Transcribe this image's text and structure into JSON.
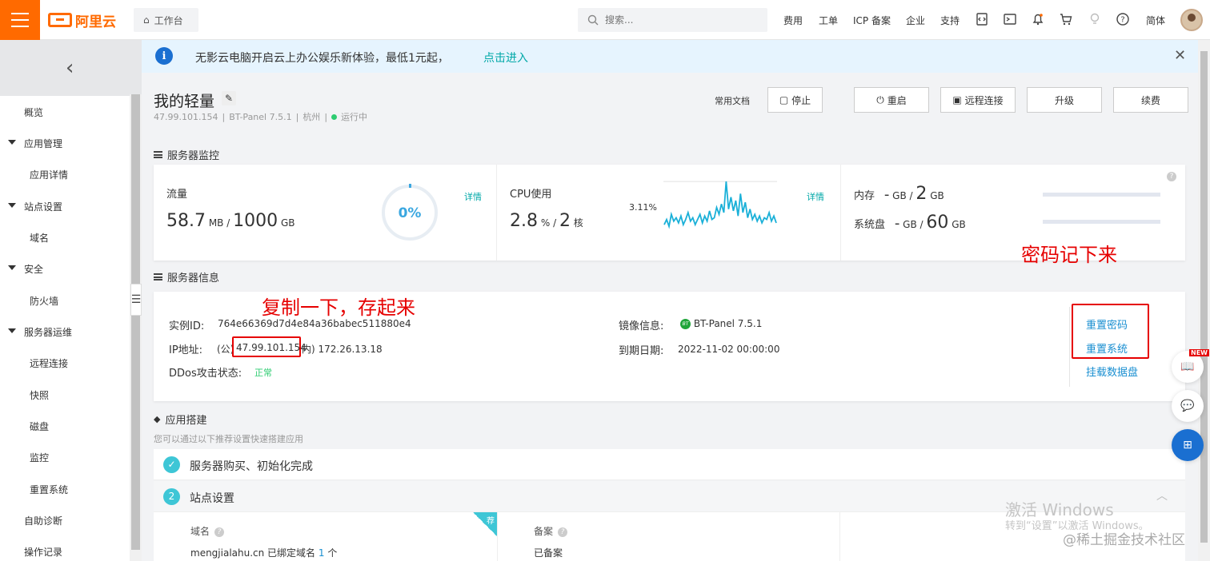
{
  "topbar": {
    "logo_text": "阿里云",
    "workbench": "工作台",
    "search_placeholder": "搜索...",
    "nav": [
      "费用",
      "工单",
      "ICP 备案",
      "企业",
      "支持"
    ],
    "lang": "简体"
  },
  "sidebar": {
    "items": [
      {
        "label": "概览"
      },
      {
        "label": "应用管理"
      },
      {
        "label": "应用详情"
      },
      {
        "label": "站点设置"
      },
      {
        "label": "域名"
      },
      {
        "label": "安全"
      },
      {
        "label": "防火墙"
      },
      {
        "label": "服务器运维"
      },
      {
        "label": "远程连接"
      },
      {
        "label": "快照"
      },
      {
        "label": "磁盘"
      },
      {
        "label": "监控"
      },
      {
        "label": "重置系统"
      },
      {
        "label": "自助诊断"
      },
      {
        "label": "操作记录"
      }
    ]
  },
  "notice": {
    "message": "无影云电脑开启云上办公娱乐新体验，最低1元起，",
    "link": "点击进入"
  },
  "header": {
    "title": "我的轻量",
    "ip": "47.99.101.154",
    "image": "BT-Panel 7.5.1",
    "region": "杭州",
    "status": "运行中",
    "docs": "常用文档",
    "buttons": {
      "stop": "停止",
      "restart": "重启",
      "remote": "远程连接",
      "upgrade": "升级",
      "renew": "续费"
    }
  },
  "monitor": {
    "section": "服务器监控",
    "traffic": {
      "label": "流量",
      "used": "58.7",
      "used_unit": "MB",
      "total": "1000",
      "total_unit": "GB",
      "percent": "0%",
      "detail": "详情"
    },
    "cpu": {
      "label": "CPU使用",
      "value": "2.8",
      "unit": "%",
      "cores": "2",
      "cores_unit": "核",
      "peak": "3.11%",
      "detail": "详情"
    },
    "memory": {
      "label": "内存",
      "used": "-",
      "used_unit": "GB",
      "total": "2",
      "total_unit": "GB"
    },
    "disk": {
      "label": "系统盘",
      "used": "-",
      "used_unit": "GB",
      "total": "60",
      "total_unit": "GB"
    }
  },
  "info": {
    "section": "服务器信息",
    "instance_label": "实例ID:",
    "instance_id": "764e66369d7d4e84a36babec511880e4",
    "ip_label": "IP地址:",
    "ip_prefix": "(公)",
    "public_ip": "47.99.101.154",
    "private_ip": "内) 172.26.13.18",
    "ddos_label": "DDos攻击状态:",
    "ddos_status": "正常",
    "image_label": "镜像信息:",
    "image_icon": "BT",
    "image_value": "BT-Panel 7.5.1",
    "expire_label": "到期日期:",
    "expire_value": "2022-11-02 00:00:00",
    "actions": [
      "重置密码",
      "重置系统",
      "挂载数据盘"
    ]
  },
  "annotations": {
    "copy_note": "复制一下，存起来",
    "password_note": "密码记下来"
  },
  "apps": {
    "section": "应用搭建",
    "hint": "您可以通过以下推荐设置快速搭建应用",
    "steps": [
      {
        "num": "✓",
        "label": "服务器购买、初始化完成"
      },
      {
        "num": "2",
        "label": "站点设置"
      }
    ],
    "domain_label": "域名",
    "domain_value": "mengjialahu.cn 已绑定域名",
    "domain_count": "1",
    "domain_suffix": "个",
    "beian_label": "备案",
    "beian_value": "已备案",
    "tag": "荐"
  },
  "float": {
    "new": "NEW"
  },
  "watermark": {
    "line1": "激活 Windows",
    "line2": "转到“设置”以激活 Windows。",
    "site": "@稀土掘金技术社区"
  },
  "colors": {
    "brand": "#ff6a00",
    "link": "#00a8a8",
    "annotation": "#e60000",
    "chart": "#1ab0d8"
  },
  "cpu_series": [
    0.6,
    0.9,
    0.5,
    1.2,
    0.8,
    1.0,
    0.7,
    1.1,
    0.6,
    0.9,
    1.3,
    0.8,
    1.0,
    0.6,
    0.9,
    1.2,
    0.7,
    1.1,
    0.8,
    1.4,
    0.9,
    1.0,
    1.6,
    1.2,
    1.8,
    1.3,
    3.11,
    1.5,
    2.2,
    1.4,
    2.0,
    1.1,
    2.4,
    1.3,
    1.9,
    1.0,
    1.5,
    0.9,
    1.2,
    0.8,
    1.1,
    0.7,
    1.0,
    0.9,
    1.3,
    0.8,
    1.1,
    0.7
  ]
}
